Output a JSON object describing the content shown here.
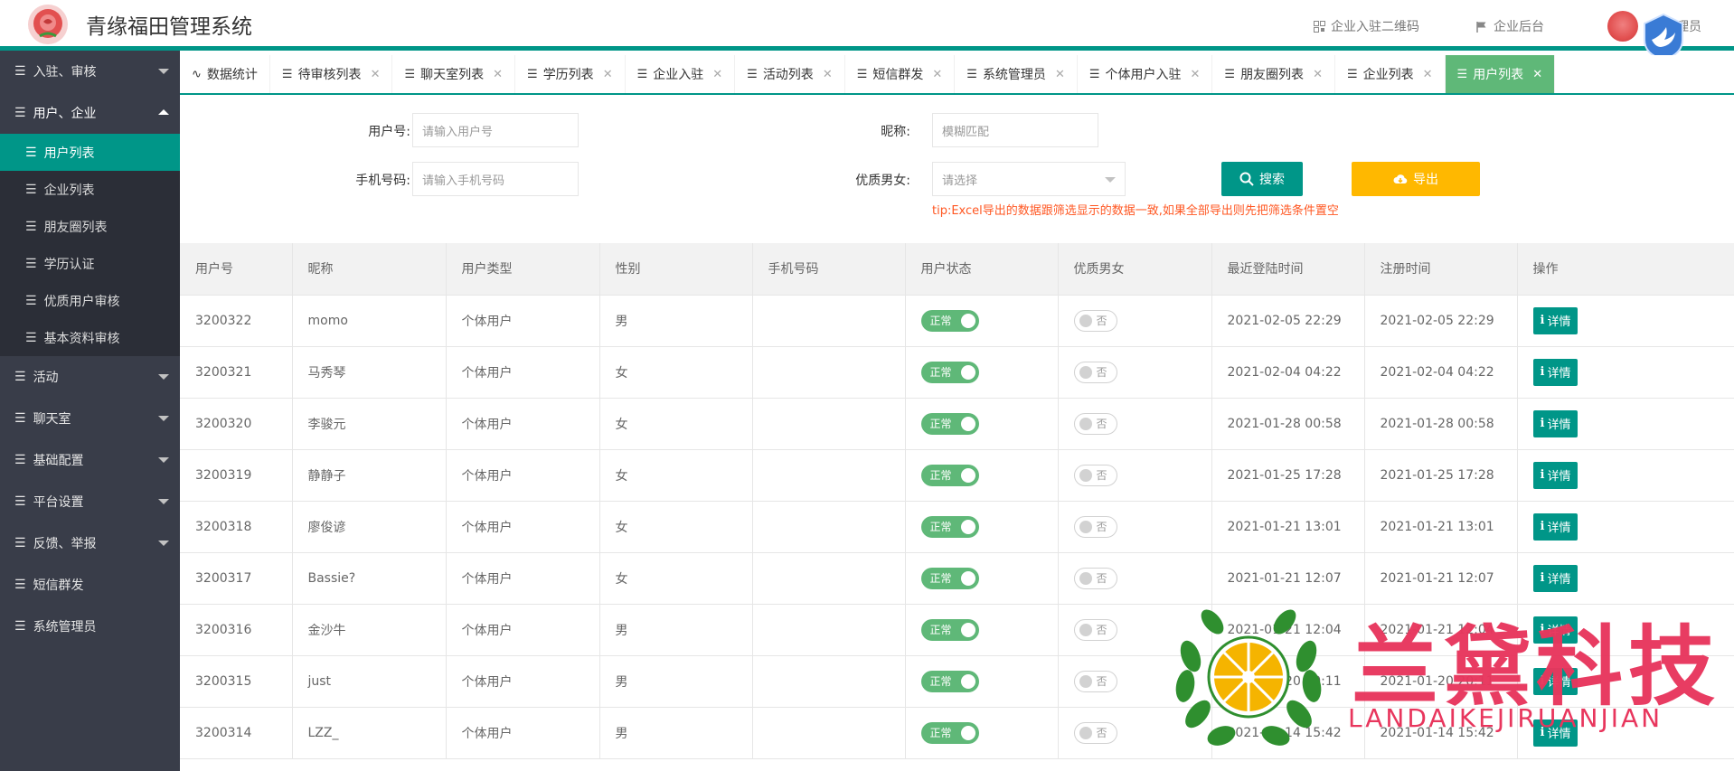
{
  "header": {
    "app_title": "青缘福田管理系统",
    "qr_link": "企业入驻二维码",
    "backend_link": "企业后台",
    "user_label": "管理员"
  },
  "sidebar": {
    "groups": [
      {
        "label": "入驻、审核",
        "icon": "list-icon",
        "state": "collapsed"
      },
      {
        "label": "用户、企业",
        "icon": "list-icon",
        "state": "expanded"
      }
    ],
    "sub_items": [
      {
        "label": "用户列表",
        "active": true
      },
      {
        "label": "企业列表"
      },
      {
        "label": "朋友圈列表"
      },
      {
        "label": "学历认证"
      },
      {
        "label": "优质用户审核"
      },
      {
        "label": "基本资料审核"
      }
    ],
    "more_groups": [
      {
        "label": "活动"
      },
      {
        "label": "聊天室"
      },
      {
        "label": "基础配置"
      },
      {
        "label": "平台设置"
      },
      {
        "label": "反馈、举报"
      }
    ],
    "singles": [
      {
        "label": "短信群发"
      },
      {
        "label": "系统管理员"
      }
    ]
  },
  "tabs": [
    {
      "label": "数据统计",
      "icon": "pulse-icon",
      "closable": false
    },
    {
      "label": "待审核列表",
      "icon": "list-icon",
      "closable": true
    },
    {
      "label": "聊天室列表",
      "icon": "list-icon",
      "closable": true
    },
    {
      "label": "学历列表",
      "icon": "list-icon",
      "closable": true
    },
    {
      "label": "企业入驻",
      "icon": "list-icon",
      "closable": true
    },
    {
      "label": "活动列表",
      "icon": "list-icon",
      "closable": true
    },
    {
      "label": "短信群发",
      "icon": "list-icon",
      "closable": true
    },
    {
      "label": "系统管理员",
      "icon": "list-icon",
      "closable": true
    },
    {
      "label": "个体用户入驻",
      "icon": "list-icon",
      "closable": true
    },
    {
      "label": "朋友圈列表",
      "icon": "list-icon",
      "closable": true
    },
    {
      "label": "企业列表",
      "icon": "list-icon",
      "closable": true
    },
    {
      "label": "用户列表",
      "icon": "list-icon",
      "closable": true,
      "active": true
    }
  ],
  "filter": {
    "user_no_label": "用户号:",
    "user_no_placeholder": "请输入用户号",
    "nickname_label": "昵称:",
    "nickname_placeholder": "模糊匹配",
    "phone_label": "手机号码:",
    "phone_placeholder": "请输入手机号码",
    "quality_label": "优质男女:",
    "quality_value": "请选择",
    "search_button": "搜索",
    "export_button": "导出",
    "tip": "tip:Excel导出的数据跟筛选显示的数据一致,如果全部导出则先把筛选条件置空"
  },
  "table": {
    "columns": [
      "用户号",
      "昵称",
      "用户类型",
      "性别",
      "手机号码",
      "用户状态",
      "优质男女",
      "最近登陆时间",
      "注册时间",
      "操作"
    ],
    "status_on_label": "正常",
    "quality_off_label": "否",
    "detail_label": "详情",
    "rows": [
      {
        "id": "3200322",
        "nick": "momo",
        "type": "个体用户",
        "gender": "男",
        "phone": "",
        "last_login": "2021-02-05 22:29",
        "registered": "2021-02-05 22:29"
      },
      {
        "id": "3200321",
        "nick": "马秀琴",
        "type": "个体用户",
        "gender": "女",
        "phone": "",
        "last_login": "2021-02-04 04:22",
        "registered": "2021-02-04 04:22"
      },
      {
        "id": "3200320",
        "nick": "李骏元",
        "type": "个体用户",
        "gender": "女",
        "phone": "",
        "last_login": "2021-01-28 00:58",
        "registered": "2021-01-28 00:58"
      },
      {
        "id": "3200319",
        "nick": "静静子",
        "type": "个体用户",
        "gender": "女",
        "phone": "",
        "last_login": "2021-01-25 17:28",
        "registered": "2021-01-25 17:28"
      },
      {
        "id": "3200318",
        "nick": "廖俊谚",
        "type": "个体用户",
        "gender": "女",
        "phone": "",
        "last_login": "2021-01-21 13:01",
        "registered": "2021-01-21 13:01"
      },
      {
        "id": "3200317",
        "nick": "Bassie?",
        "type": "个体用户",
        "gender": "女",
        "phone": "",
        "last_login": "2021-01-21 12:07",
        "registered": "2021-01-21 12:07"
      },
      {
        "id": "3200316",
        "nick": "金沙牛",
        "type": "个体用户",
        "gender": "男",
        "phone": "",
        "last_login": "2021-01-21 12:04",
        "registered": "2021-01-21 12:04"
      },
      {
        "id": "3200315",
        "nick": "just",
        "type": "个体用户",
        "gender": "男",
        "phone": "",
        "last_login": "2021-01-20 20:11",
        "registered": "2021-01-20 20:11"
      },
      {
        "id": "3200314",
        "nick": "LZZ_",
        "type": "个体用户",
        "gender": "男",
        "phone": "",
        "last_login": "2021-01-14 15:42",
        "registered": "2021-01-14 15:42"
      }
    ]
  },
  "watermark": {
    "title": "兰黛科技",
    "subtitle": "LANDAIKEJIRUANJIAN"
  },
  "colors": {
    "primary": "#009688",
    "active_tab": "#5fb878",
    "sidebar": "#393d49",
    "export": "#ffb800",
    "tip": "#ff5722",
    "watermark": "#e8365d"
  }
}
